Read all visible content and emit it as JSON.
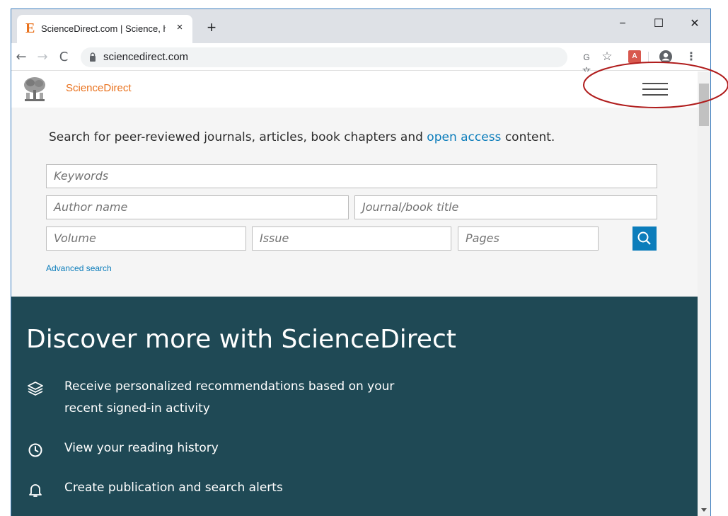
{
  "browser": {
    "tab": {
      "favicon": "E",
      "title": "ScienceDirect.com | Science, h",
      "close": "×"
    },
    "new_tab": "+",
    "window_controls": {
      "minimize": "−",
      "maximize": "☐",
      "close": "✕"
    },
    "nav": {
      "back": "←",
      "forward": "→",
      "reload": "C"
    },
    "address": "sciencedirect.com",
    "icons": {
      "translate": "translate-icon",
      "bookmark": "star-icon",
      "extension": "pdf-icon",
      "profile": "profile-icon",
      "menu": "kebab-menu-icon"
    },
    "extension_label": "A",
    "star_glyph": "☆",
    "translate_glyph": "G文",
    "menu_glyph": "⋮"
  },
  "site": {
    "name": "ScienceDirect",
    "search": {
      "prompt_before": "Search for peer-reviewed journals, articles, book chapters and ",
      "prompt_link": "open access",
      "prompt_after": " content.",
      "keywords_placeholder": "Keywords",
      "author_placeholder": "Author name",
      "journal_placeholder": "Journal/book title",
      "volume_placeholder": "Volume",
      "issue_placeholder": "Issue",
      "pages_placeholder": "Pages",
      "advanced_link": "Advanced search"
    },
    "discover": {
      "title": "Discover more with ScienceDirect",
      "features": [
        {
          "icon": "layers-icon",
          "text": "Receive personalized recommendations based on your recent signed-in activity"
        },
        {
          "icon": "clock-icon",
          "text": "View your reading history"
        },
        {
          "icon": "bell-icon",
          "text": "Create publication and search alerts"
        }
      ]
    }
  },
  "colors": {
    "brand_orange": "#e9711c",
    "link_blue": "#0c7dbb",
    "discover_bg": "#1f4955",
    "annotation_red": "#b01c1c"
  }
}
